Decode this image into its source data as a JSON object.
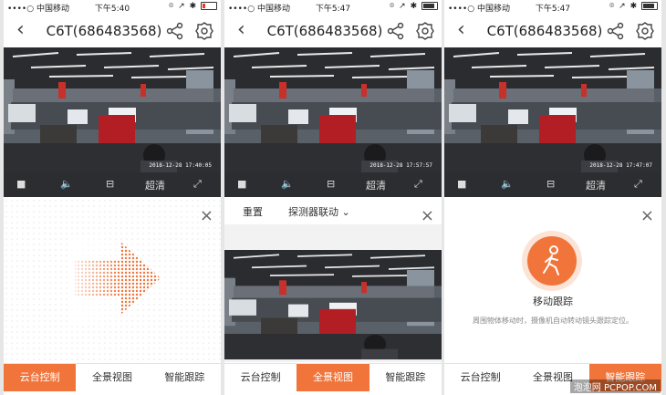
{
  "common": {
    "title": "C6T(686483568)",
    "tabs": [
      "云台控制",
      "全景视图",
      "智能跟踪"
    ],
    "quality": "超清",
    "close": "×"
  },
  "panels": [
    {
      "carrier": "••••○ 中国移动",
      "time": "下午5:40",
      "battery_level": 0.2,
      "battery_low": true,
      "active_tab": 0,
      "timestamp": "2018-12-28 17:40:05"
    },
    {
      "carrier": "••••○ 中国移动",
      "time": "下午5:47",
      "battery_level": 0.85,
      "battery_low": false,
      "active_tab": 1,
      "timestamp": "2018-12-28 17:57:57",
      "reset": "重置",
      "linkage": "探测器联动"
    },
    {
      "carrier": "••••○ 中国移动",
      "time": "下午5:47",
      "battery_level": 0.85,
      "battery_low": false,
      "active_tab": 2,
      "timestamp": "2018-12-28 17:47:07",
      "track_label": "移动跟踪",
      "track_desc": "周围物体移动时，摄像机自动转动镜头跟踪定位。"
    }
  ],
  "colors": {
    "accent": "#f1743a"
  },
  "watermark": "泡泡网 PCPOP.COM"
}
